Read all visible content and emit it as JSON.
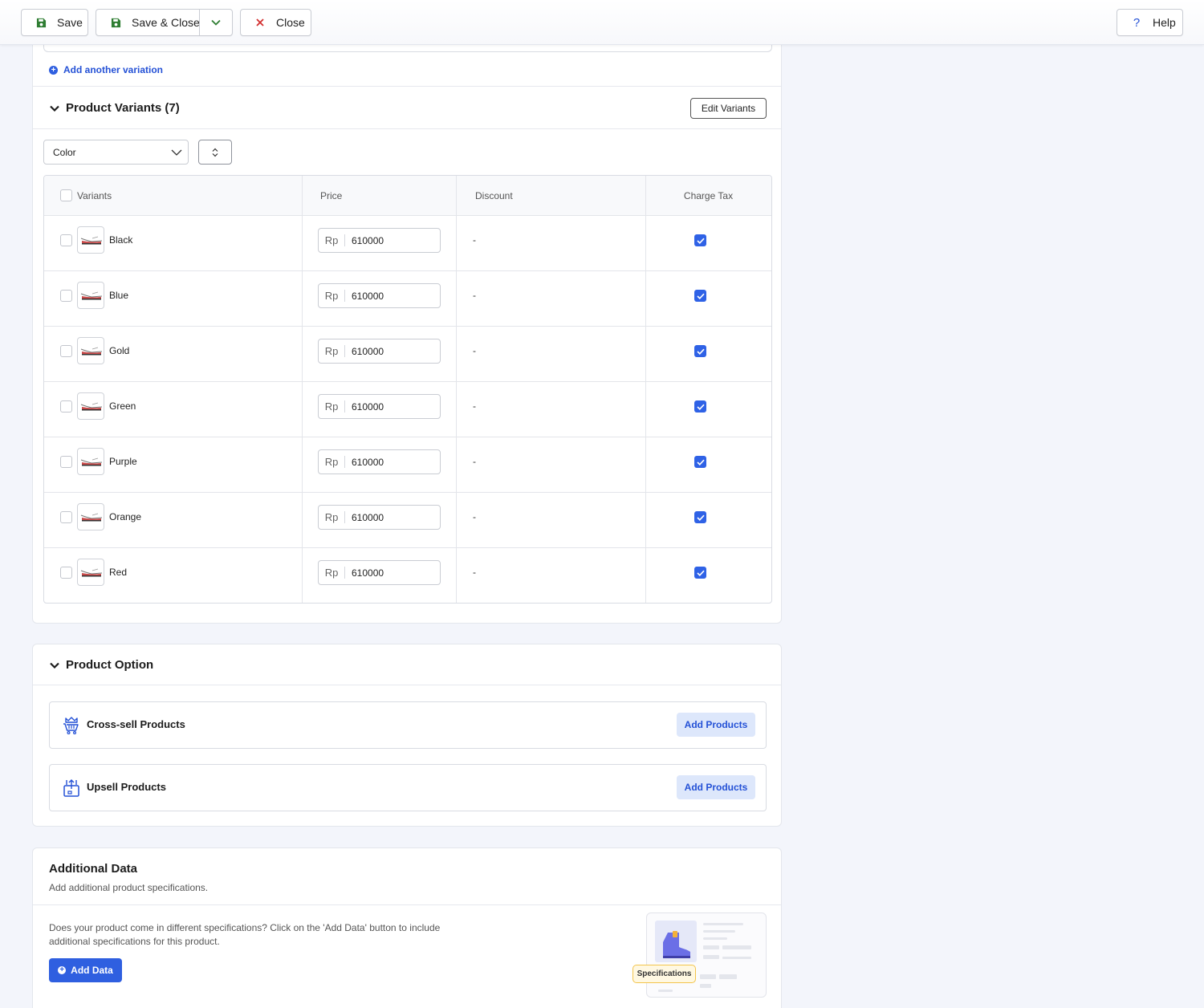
{
  "toolbar": {
    "save_label": "Save",
    "save_close_label": "Save & Close",
    "close_label": "Close",
    "help_label": "Help"
  },
  "variations": {
    "add_another_label": "Add another variation"
  },
  "product_variants": {
    "title": "Product Variants (7)",
    "edit_button": "Edit Variants",
    "group_by_select": "Color",
    "columns": [
      "Variants",
      "Price",
      "Discount",
      "Charge Tax"
    ],
    "rows": [
      {
        "name": "Black",
        "currency": "Rp",
        "price": "610000",
        "discount": "-",
        "charge_tax": true,
        "selected": false
      },
      {
        "name": "Blue",
        "currency": "Rp",
        "price": "610000",
        "discount": "-",
        "charge_tax": true,
        "selected": false
      },
      {
        "name": "Gold",
        "currency": "Rp",
        "price": "610000",
        "discount": "-",
        "charge_tax": true,
        "selected": false
      },
      {
        "name": "Green",
        "currency": "Rp",
        "price": "610000",
        "discount": "-",
        "charge_tax": true,
        "selected": false
      },
      {
        "name": "Purple",
        "currency": "Rp",
        "price": "610000",
        "discount": "-",
        "charge_tax": true,
        "selected": false
      },
      {
        "name": "Orange",
        "currency": "Rp",
        "price": "610000",
        "discount": "-",
        "charge_tax": true,
        "selected": false
      },
      {
        "name": "Red",
        "currency": "Rp",
        "price": "610000",
        "discount": "-",
        "charge_tax": true,
        "selected": false
      }
    ]
  },
  "product_option": {
    "title": "Product Option",
    "cross_sell": {
      "label": "Cross-sell Products",
      "button": "Add Products",
      "icon": "cart-crown-icon"
    },
    "upsell": {
      "label": "Upsell Products",
      "button": "Add Products",
      "icon": "box-up-icon"
    }
  },
  "additional_data": {
    "title": "Additional Data",
    "subtitle": "Add additional product specifications.",
    "description": "Does your product come in different specifications? Click on the 'Add Data' button to include additional specifications for this product.",
    "button": "Add Data",
    "badge": "Specifications"
  },
  "colors": {
    "accent": "#2f5fe0",
    "link": "#2451d6",
    "save_icon": "#2e7d32",
    "close_icon": "#d32f2f"
  }
}
